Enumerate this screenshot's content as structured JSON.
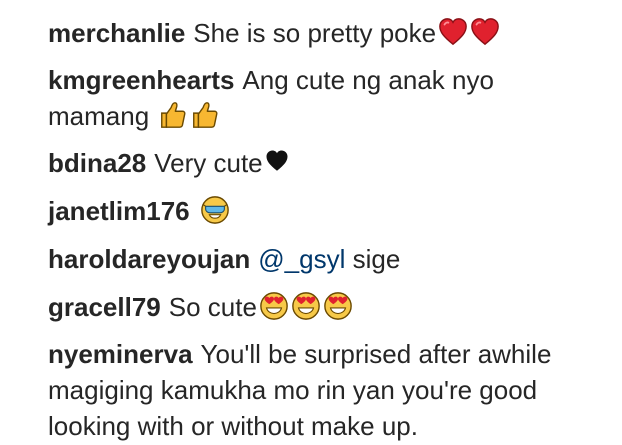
{
  "comments": [
    {
      "user": "merchanlie",
      "text": "She is so pretty poke",
      "emojis": [
        "red-heart-icon",
        "red-heart-icon"
      ]
    },
    {
      "user": "kmgreenhearts",
      "text": "Ang cute ng anak nyo mamang",
      "emojis": [
        "thumbs-up-icon",
        "thumbs-up-icon"
      ]
    },
    {
      "user": "bdina28",
      "text": "Very cute",
      "emojis": [
        "black-heart-icon"
      ]
    },
    {
      "user": "janetlim176",
      "text": "",
      "emojis": [
        "star-struck-face-icon"
      ]
    },
    {
      "user": "haroldareyoujan",
      "mention": "@_gsyl",
      "text": "sige",
      "emojis": []
    },
    {
      "user": "gracell79",
      "text": "So cute",
      "emojis": [
        "heart-eyes-face-icon",
        "heart-eyes-face-icon",
        "heart-eyes-face-icon"
      ]
    },
    {
      "user": "nyeminerva",
      "text": "You'll be surprised after awhile magiging kamukha mo rin yan you're good looking with or without make up.",
      "emojis": []
    }
  ],
  "colors": {
    "username": "#262626",
    "mention": "#00376b",
    "heart_red": "#e0212e",
    "thumb_yellow": "#f7b731"
  }
}
